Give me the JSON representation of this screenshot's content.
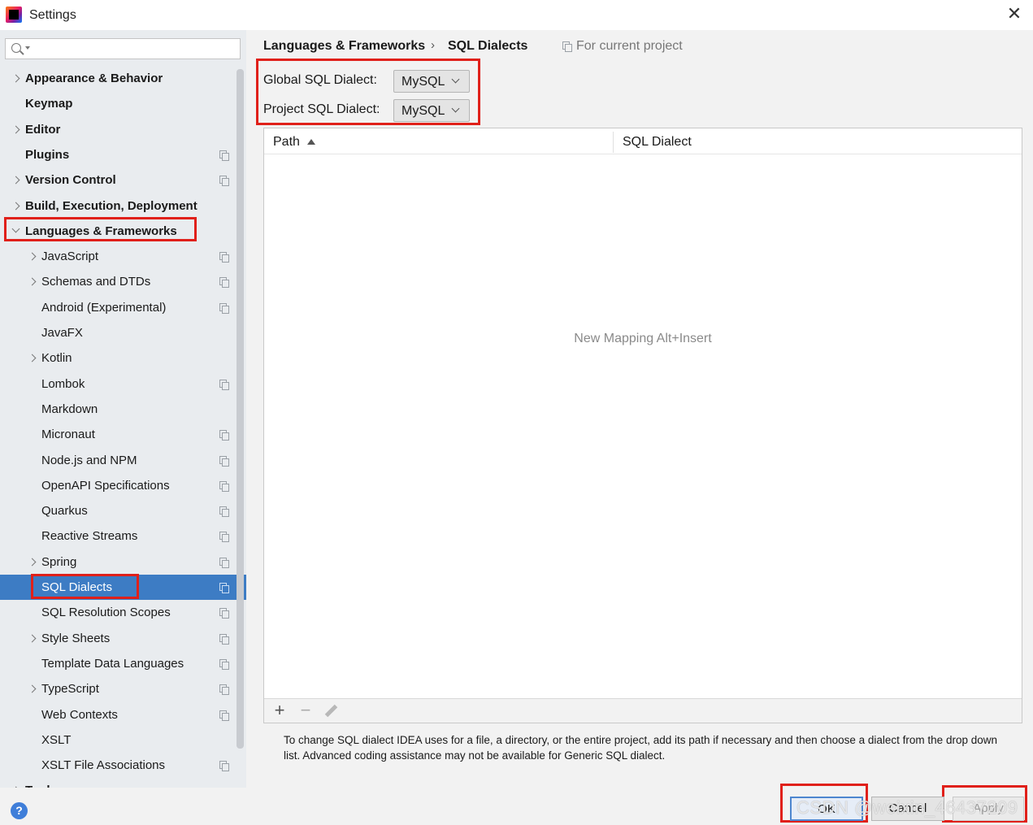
{
  "window": {
    "title": "Settings"
  },
  "search": {
    "placeholder": ""
  },
  "tree": [
    {
      "label": "Appearance & Behavior",
      "bold": true,
      "chevron": "closed",
      "project": false,
      "indent": 0
    },
    {
      "label": "Keymap",
      "bold": true,
      "chevron": "none",
      "project": false,
      "indent": 0
    },
    {
      "label": "Editor",
      "bold": true,
      "chevron": "closed",
      "project": false,
      "indent": 0
    },
    {
      "label": "Plugins",
      "bold": true,
      "chevron": "none",
      "project": true,
      "indent": 0
    },
    {
      "label": "Version Control",
      "bold": true,
      "chevron": "closed",
      "project": true,
      "indent": 0
    },
    {
      "label": "Build, Execution, Deployment",
      "bold": true,
      "chevron": "closed",
      "project": false,
      "indent": 0
    },
    {
      "label": "Languages & Frameworks",
      "bold": true,
      "chevron": "open",
      "project": false,
      "indent": 0
    },
    {
      "label": "JavaScript",
      "bold": false,
      "chevron": "closed",
      "project": true,
      "indent": 1
    },
    {
      "label": "Schemas and DTDs",
      "bold": false,
      "chevron": "closed",
      "project": true,
      "indent": 1
    },
    {
      "label": "Android (Experimental)",
      "bold": false,
      "chevron": "none",
      "project": true,
      "indent": 1
    },
    {
      "label": "JavaFX",
      "bold": false,
      "chevron": "none",
      "project": false,
      "indent": 1
    },
    {
      "label": "Kotlin",
      "bold": false,
      "chevron": "closed",
      "project": false,
      "indent": 1
    },
    {
      "label": "Lombok",
      "bold": false,
      "chevron": "none",
      "project": true,
      "indent": 1
    },
    {
      "label": "Markdown",
      "bold": false,
      "chevron": "none",
      "project": false,
      "indent": 1
    },
    {
      "label": "Micronaut",
      "bold": false,
      "chevron": "none",
      "project": true,
      "indent": 1
    },
    {
      "label": "Node.js and NPM",
      "bold": false,
      "chevron": "none",
      "project": true,
      "indent": 1
    },
    {
      "label": "OpenAPI Specifications",
      "bold": false,
      "chevron": "none",
      "project": true,
      "indent": 1
    },
    {
      "label": "Quarkus",
      "bold": false,
      "chevron": "none",
      "project": true,
      "indent": 1
    },
    {
      "label": "Reactive Streams",
      "bold": false,
      "chevron": "none",
      "project": true,
      "indent": 1
    },
    {
      "label": "Spring",
      "bold": false,
      "chevron": "closed",
      "project": true,
      "indent": 1
    },
    {
      "label": "SQL Dialects",
      "bold": false,
      "chevron": "none",
      "project": true,
      "indent": 1,
      "selected": true
    },
    {
      "label": "SQL Resolution Scopes",
      "bold": false,
      "chevron": "none",
      "project": true,
      "indent": 1
    },
    {
      "label": "Style Sheets",
      "bold": false,
      "chevron": "closed",
      "project": true,
      "indent": 1
    },
    {
      "label": "Template Data Languages",
      "bold": false,
      "chevron": "none",
      "project": true,
      "indent": 1
    },
    {
      "label": "TypeScript",
      "bold": false,
      "chevron": "closed",
      "project": true,
      "indent": 1
    },
    {
      "label": "Web Contexts",
      "bold": false,
      "chevron": "none",
      "project": true,
      "indent": 1
    },
    {
      "label": "XSLT",
      "bold": false,
      "chevron": "none",
      "project": false,
      "indent": 1
    },
    {
      "label": "XSLT File Associations",
      "bold": false,
      "chevron": "none",
      "project": true,
      "indent": 1
    },
    {
      "label": "Tools",
      "bold": true,
      "chevron": "closed",
      "project": false,
      "indent": 0
    }
  ],
  "breadcrumb": {
    "parent": "Languages & Frameworks",
    "separator": "›",
    "current": "SQL Dialects",
    "scope": "For current project"
  },
  "dialects": {
    "global_label": "Global SQL Dialect:",
    "global_value": "MySQL",
    "project_label": "Project SQL Dialect:",
    "project_value": "MySQL"
  },
  "table": {
    "col_path": "Path",
    "col_dialect": "SQL Dialect",
    "empty_text": "New Mapping Alt+Insert"
  },
  "toolbar": {
    "add": "+",
    "remove": "−"
  },
  "help_text": "To change SQL dialect IDEA uses for a file, a directory, or the entire project, add its path if necessary and then choose a dialect from the drop down list. Advanced coding assistance may not be available for Generic SQL dialect.",
  "buttons": {
    "help": "?",
    "ok": "OK",
    "cancel": "Cancel",
    "apply": "Apply"
  },
  "watermark": "CSDN @weixin_46437209",
  "colors": {
    "selection": "#3d7cc4",
    "annotation_red": "#e0201a",
    "sidebar_bg": "#e9ecef"
  }
}
